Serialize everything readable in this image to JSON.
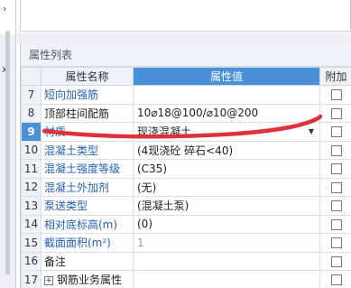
{
  "left": {
    "chevron": "›",
    "mark": "x"
  },
  "panel": {
    "title": "属性列表",
    "headers": {
      "name": "属性名称",
      "value": "属性值",
      "add": "附加"
    },
    "rows": [
      {
        "idx": "7",
        "name": "短向加强筋",
        "value": "",
        "name_color": "blue"
      },
      {
        "idx": "8",
        "name": "顶部柱间配筋",
        "value": "10⌀18@100/⌀10@200",
        "name_color": "black"
      },
      {
        "idx": "9",
        "name": "材质",
        "value": "现浇混凝土",
        "name_color": "blue",
        "selected": true
      },
      {
        "idx": "10",
        "name": "混凝土类型",
        "value": "(4现浇砼 碎石<40)",
        "name_color": "blue"
      },
      {
        "idx": "11",
        "name": "混凝土强度等级",
        "value": "(C35)",
        "name_color": "blue"
      },
      {
        "idx": "12",
        "name": "混凝土外加剂",
        "value": "(无)",
        "name_color": "blue"
      },
      {
        "idx": "13",
        "name": "泵送类型",
        "value": "(混凝土泵)",
        "name_color": "blue"
      },
      {
        "idx": "14",
        "name": "相对底标高(m)",
        "value": "(0)",
        "name_color": "blue"
      },
      {
        "idx": "15",
        "name": "截面面积(m²)",
        "value": "1",
        "name_color": "blue",
        "value_gray": true
      },
      {
        "idx": "16",
        "name": "备注",
        "value": "",
        "name_color": "black"
      },
      {
        "idx": "17",
        "name": "钢筋业务属性",
        "value": "",
        "name_color": "black",
        "expand": "+"
      }
    ]
  },
  "colors": {
    "header_accent": "#4a90d9",
    "link_text": "#2460b8",
    "annotation": "#e0303a"
  }
}
